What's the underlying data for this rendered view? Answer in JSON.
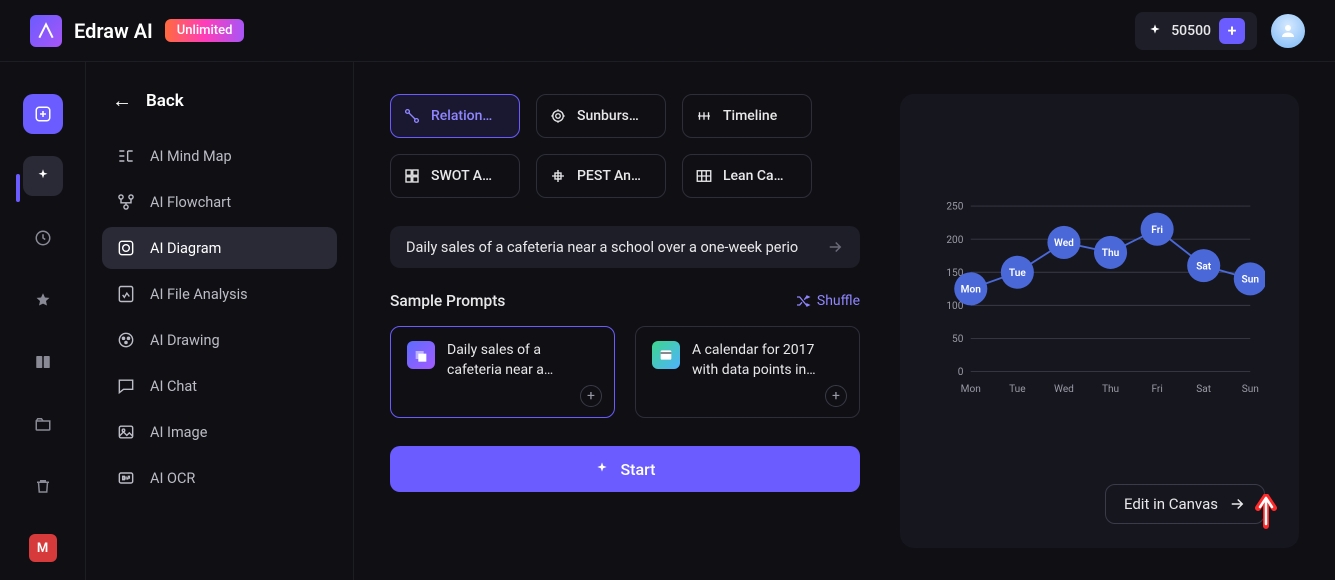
{
  "header": {
    "brand": "Edraw AI",
    "badge": "Unlimited",
    "credits": "50500"
  },
  "rail": {
    "bottom_badge": "M"
  },
  "sidebar": {
    "back_label": "Back",
    "items": [
      {
        "label": "AI Mind Map"
      },
      {
        "label": "AI Flowchart"
      },
      {
        "label": "AI Diagram"
      },
      {
        "label": "AI File Analysis"
      },
      {
        "label": "AI Drawing"
      },
      {
        "label": "AI Chat"
      },
      {
        "label": "AI Image"
      },
      {
        "label": "AI OCR"
      }
    ]
  },
  "chips": [
    {
      "label": "Relation…"
    },
    {
      "label": "Sunburs…"
    },
    {
      "label": "Timeline"
    },
    {
      "label": "SWOT A…"
    },
    {
      "label": "PEST An…"
    },
    {
      "label": "Lean Ca…"
    }
  ],
  "prompt": {
    "text": "Daily sales of a cafeteria near a school over a one-week perio"
  },
  "samples": {
    "title": "Sample Prompts",
    "shuffle": "Shuffle",
    "cards": [
      {
        "text": "Daily sales of a cafeteria near a…"
      },
      {
        "text": "A calendar for 2017 with data points in…"
      }
    ]
  },
  "start_label": "Start",
  "preview": {
    "edit_label": "Edit in Canvas"
  },
  "chart_data": {
    "type": "line",
    "title": "",
    "xlabel": "",
    "ylabel": "",
    "ylim": [
      0,
      250
    ],
    "y_ticks": [
      0,
      50,
      100,
      150,
      200,
      250
    ],
    "categories": [
      "Mon",
      "Tue",
      "Wed",
      "Thu",
      "Fri",
      "Sat",
      "Sun"
    ],
    "values": [
      125,
      150,
      195,
      180,
      215,
      160,
      140
    ]
  }
}
